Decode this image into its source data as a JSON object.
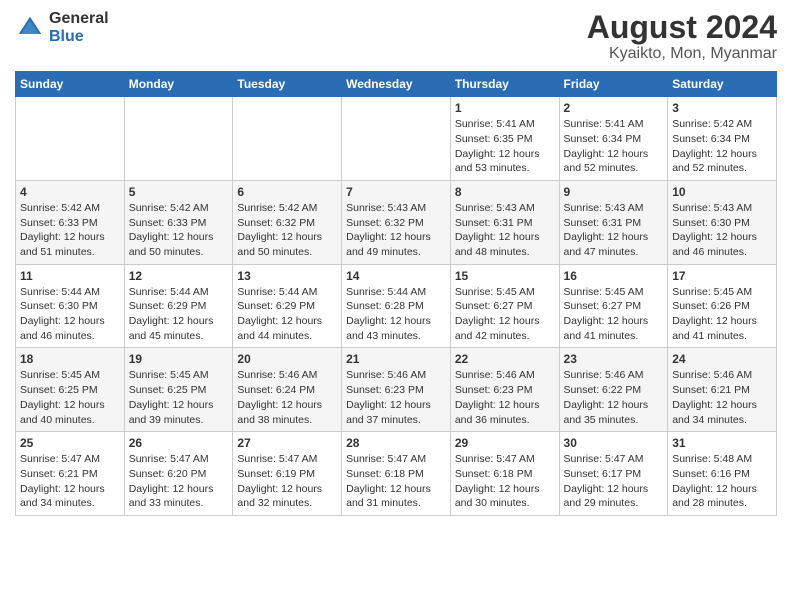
{
  "header": {
    "logo_general": "General",
    "logo_blue": "Blue",
    "main_title": "August 2024",
    "subtitle": "Kyaikto, Mon, Myanmar"
  },
  "calendar": {
    "days_of_week": [
      "Sunday",
      "Monday",
      "Tuesday",
      "Wednesday",
      "Thursday",
      "Friday",
      "Saturday"
    ],
    "weeks": [
      {
        "days": [
          {
            "date": "",
            "info": ""
          },
          {
            "date": "",
            "info": ""
          },
          {
            "date": "",
            "info": ""
          },
          {
            "date": "",
            "info": ""
          },
          {
            "date": "1",
            "info": "Sunrise: 5:41 AM\nSunset: 6:35 PM\nDaylight: 12 hours\nand 53 minutes."
          },
          {
            "date": "2",
            "info": "Sunrise: 5:41 AM\nSunset: 6:34 PM\nDaylight: 12 hours\nand 52 minutes."
          },
          {
            "date": "3",
            "info": "Sunrise: 5:42 AM\nSunset: 6:34 PM\nDaylight: 12 hours\nand 52 minutes."
          }
        ]
      },
      {
        "days": [
          {
            "date": "4",
            "info": "Sunrise: 5:42 AM\nSunset: 6:33 PM\nDaylight: 12 hours\nand 51 minutes."
          },
          {
            "date": "5",
            "info": "Sunrise: 5:42 AM\nSunset: 6:33 PM\nDaylight: 12 hours\nand 50 minutes."
          },
          {
            "date": "6",
            "info": "Sunrise: 5:42 AM\nSunset: 6:32 PM\nDaylight: 12 hours\nand 50 minutes."
          },
          {
            "date": "7",
            "info": "Sunrise: 5:43 AM\nSunset: 6:32 PM\nDaylight: 12 hours\nand 49 minutes."
          },
          {
            "date": "8",
            "info": "Sunrise: 5:43 AM\nSunset: 6:31 PM\nDaylight: 12 hours\nand 48 minutes."
          },
          {
            "date": "9",
            "info": "Sunrise: 5:43 AM\nSunset: 6:31 PM\nDaylight: 12 hours\nand 47 minutes."
          },
          {
            "date": "10",
            "info": "Sunrise: 5:43 AM\nSunset: 6:30 PM\nDaylight: 12 hours\nand 46 minutes."
          }
        ]
      },
      {
        "days": [
          {
            "date": "11",
            "info": "Sunrise: 5:44 AM\nSunset: 6:30 PM\nDaylight: 12 hours\nand 46 minutes."
          },
          {
            "date": "12",
            "info": "Sunrise: 5:44 AM\nSunset: 6:29 PM\nDaylight: 12 hours\nand 45 minutes."
          },
          {
            "date": "13",
            "info": "Sunrise: 5:44 AM\nSunset: 6:29 PM\nDaylight: 12 hours\nand 44 minutes."
          },
          {
            "date": "14",
            "info": "Sunrise: 5:44 AM\nSunset: 6:28 PM\nDaylight: 12 hours\nand 43 minutes."
          },
          {
            "date": "15",
            "info": "Sunrise: 5:45 AM\nSunset: 6:27 PM\nDaylight: 12 hours\nand 42 minutes."
          },
          {
            "date": "16",
            "info": "Sunrise: 5:45 AM\nSunset: 6:27 PM\nDaylight: 12 hours\nand 41 minutes."
          },
          {
            "date": "17",
            "info": "Sunrise: 5:45 AM\nSunset: 6:26 PM\nDaylight: 12 hours\nand 41 minutes."
          }
        ]
      },
      {
        "days": [
          {
            "date": "18",
            "info": "Sunrise: 5:45 AM\nSunset: 6:25 PM\nDaylight: 12 hours\nand 40 minutes."
          },
          {
            "date": "19",
            "info": "Sunrise: 5:45 AM\nSunset: 6:25 PM\nDaylight: 12 hours\nand 39 minutes."
          },
          {
            "date": "20",
            "info": "Sunrise: 5:46 AM\nSunset: 6:24 PM\nDaylight: 12 hours\nand 38 minutes."
          },
          {
            "date": "21",
            "info": "Sunrise: 5:46 AM\nSunset: 6:23 PM\nDaylight: 12 hours\nand 37 minutes."
          },
          {
            "date": "22",
            "info": "Sunrise: 5:46 AM\nSunset: 6:23 PM\nDaylight: 12 hours\nand 36 minutes."
          },
          {
            "date": "23",
            "info": "Sunrise: 5:46 AM\nSunset: 6:22 PM\nDaylight: 12 hours\nand 35 minutes."
          },
          {
            "date": "24",
            "info": "Sunrise: 5:46 AM\nSunset: 6:21 PM\nDaylight: 12 hours\nand 34 minutes."
          }
        ]
      },
      {
        "days": [
          {
            "date": "25",
            "info": "Sunrise: 5:47 AM\nSunset: 6:21 PM\nDaylight: 12 hours\nand 34 minutes."
          },
          {
            "date": "26",
            "info": "Sunrise: 5:47 AM\nSunset: 6:20 PM\nDaylight: 12 hours\nand 33 minutes."
          },
          {
            "date": "27",
            "info": "Sunrise: 5:47 AM\nSunset: 6:19 PM\nDaylight: 12 hours\nand 32 minutes."
          },
          {
            "date": "28",
            "info": "Sunrise: 5:47 AM\nSunset: 6:18 PM\nDaylight: 12 hours\nand 31 minutes."
          },
          {
            "date": "29",
            "info": "Sunrise: 5:47 AM\nSunset: 6:18 PM\nDaylight: 12 hours\nand 30 minutes."
          },
          {
            "date": "30",
            "info": "Sunrise: 5:47 AM\nSunset: 6:17 PM\nDaylight: 12 hours\nand 29 minutes."
          },
          {
            "date": "31",
            "info": "Sunrise: 5:48 AM\nSunset: 6:16 PM\nDaylight: 12 hours\nand 28 minutes."
          }
        ]
      }
    ]
  }
}
